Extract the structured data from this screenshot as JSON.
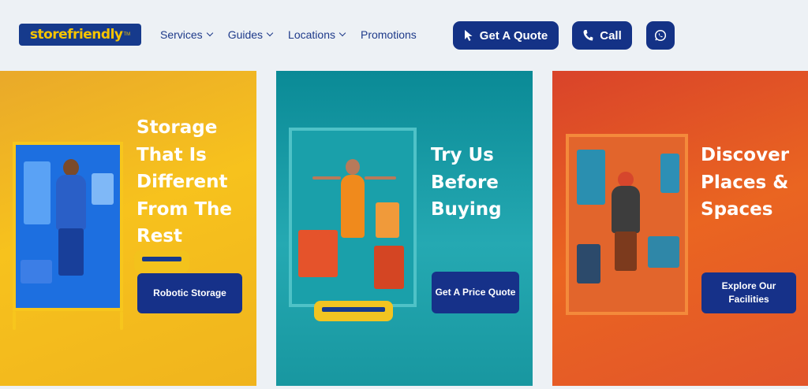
{
  "header": {
    "logo_text": "storefriendly",
    "logo_tm": "TM",
    "nav": [
      {
        "label": "Services",
        "has_dropdown": true
      },
      {
        "label": "Guides",
        "has_dropdown": true
      },
      {
        "label": "Locations",
        "has_dropdown": true
      },
      {
        "label": "Promotions",
        "has_dropdown": false
      }
    ],
    "quote_button": "Get A Quote",
    "call_button": "Call",
    "whatsapp_icon": "whatsapp-icon"
  },
  "cards": [
    {
      "heading": "Storage That Is Different From The Rest",
      "button": "Robotic Storage",
      "color": "#f7c21d"
    },
    {
      "heading": "Try Us Before Buying",
      "button": "Get A Price Quote",
      "color": "#25a9b2"
    },
    {
      "heading": "Discover Places & Spaces",
      "button": "Explore Our Facilities",
      "color": "#ea6521"
    }
  ],
  "colors": {
    "brand_blue": "#143286",
    "brand_yellow": "#f5c400",
    "page_bg": "#edf1f5"
  }
}
